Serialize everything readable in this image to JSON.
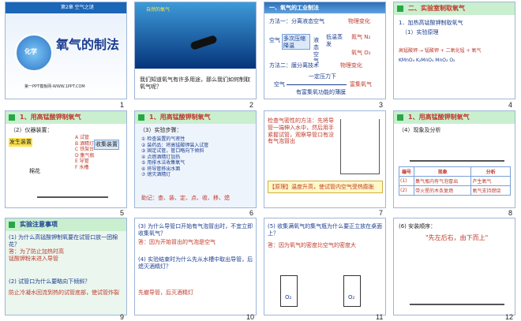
{
  "s1": {
    "chapter": "第2章 空气之谜",
    "title": "氧气的制法",
    "badge": "化学",
    "site": "第一PPT模板网-WWW.1PPT.COM",
    "num": "1"
  },
  "s2": {
    "tag": "自然的氧气",
    "q": "我们知道氧气有许多用途，那么我们如何制取氧气呢？",
    "num": "2"
  },
  "s3": {
    "head": "一、氧气的工业制法",
    "m1": "方法一：分离液态空气",
    "r1": "物理变化",
    "air": "空气",
    "step": "多次压缩降温",
    "low": "低温蒸发",
    "liq": "液态空气",
    "n2": "氮气 N₂",
    "o2": "氧气 O₂",
    "m2": "方法二：膜分离技术",
    "r2": "物理变化",
    "press": "一定压力下",
    "rich": "富集氧气",
    "film": "有富集氧功能的薄膜",
    "air2": "空气",
    "num": "3"
  },
  "s4": {
    "head": "二、实验室制取氧气",
    "sub": "1．加热高锰酸钾制取氧气",
    "p": "（1）实验原理",
    "eq": "高锰酸钾 → 锰酸钾 + 二氧化锰 + 氧气",
    "f": "KMnO₄   K₂MnO₄   MnO₂   O₂",
    "num": "4"
  },
  "s5": {
    "head": "1、用高锰酸钾制氧气",
    "p": "（2）仪器装置：",
    "gen": "发生装置",
    "col": "收集装置",
    "cotton": "棉花",
    "labels": [
      "A 试管",
      "B 酒精灯",
      "C 铁架台",
      "D 集气瓶",
      "E 导管",
      "F 水槽"
    ],
    "num": "5"
  },
  "s6": {
    "head": "1、用高锰酸钾制氧气",
    "p": "（3）实验步骤：",
    "steps": [
      "① 检查装置的气密性",
      "② 装药品：将高锰酸钾装入试管",
      "③ 固定试管，管口略向下倾斜",
      "④ 点燃酒精灯加热",
      "⑤ 用排水法收集氧气",
      "⑥ 将导管移出水面",
      "⑦ 熄灭酒精灯"
    ],
    "mem": "助记：查、装、定、点、收、移、熄",
    "num": "6"
  },
  "s7": {
    "t": "检查气密性的方法：先将导管一端伸入水中，然后用手紧握试管，观察导管口有没有气泡冒出",
    "tip": "【原理】温度升高，使试管内空气受热膨胀",
    "num": "7"
  },
  "s8": {
    "head": "1、用高锰酸钾制氧气",
    "p": "（4）现象及分析",
    "cols": [
      "编号",
      "现象",
      "分析"
    ],
    "rows": [
      [
        "(1)",
        "集气瓶内有气泡冒出",
        "产生氧气"
      ],
      [
        "(2)",
        "带火星的木条复燃",
        "氧气支持燃烧"
      ]
    ],
    "num": "8"
  },
  "s9": {
    "head": "实验注意事项",
    "q1": "(1) 为什么高锰酸钾制氧要在试管口放一团棉花？",
    "a1": "答：为了防止加热时高锰酸钾粉末进入导管",
    "q2": "(2) 试管口为什么要略向下倾斜？",
    "a2": "防止冷凝水回流到热的试管底部，使试管炸裂",
    "num": "9"
  },
  "s10": {
    "q3": "(3) 为什么导管口开始有气泡冒出时，不宜立即收集氧气？",
    "a3": "答：因为开始冒出的气泡是空气",
    "q4": "(4) 实验结束时为什么先从水槽中取出导管，后熄灭酒精灯？",
    "a4": "先撤导管，后灭酒精灯",
    "num": "10"
  },
  "s11": {
    "q5": "(5) 收集满氧气的集气瓶为什么要正立放在桌面上？",
    "a5": "答：因为氧气的密度比空气的密度大",
    "o2a": "O₂",
    "o2b": "O₂",
    "num": "11"
  },
  "s12": {
    "p": "(6) 安装顺序：",
    "order": "\"先左后右，由下而上\"",
    "num": "12"
  }
}
